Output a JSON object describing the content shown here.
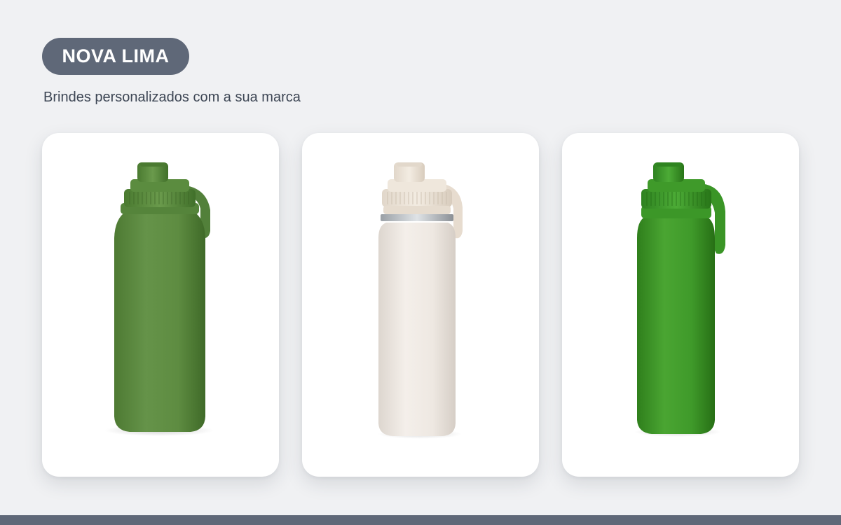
{
  "header": {
    "brand": "NOVA LIMA",
    "tagline": "Brindes personalizados com a sua marca"
  },
  "products": [
    {
      "name": "green water bottle",
      "body_color": "#5e8c41",
      "cap_color": "#5a8a3e"
    },
    {
      "name": "cream water bottle",
      "body_color": "#efe9e3",
      "cap_color": "#ece3d7"
    },
    {
      "name": "bright green water bottle",
      "body_color": "#3f9a2a",
      "cap_color": "#3f9a2a"
    }
  ],
  "colors": {
    "background": "#f0f1f3",
    "accent": "#5f6878",
    "text": "#3d4654"
  }
}
